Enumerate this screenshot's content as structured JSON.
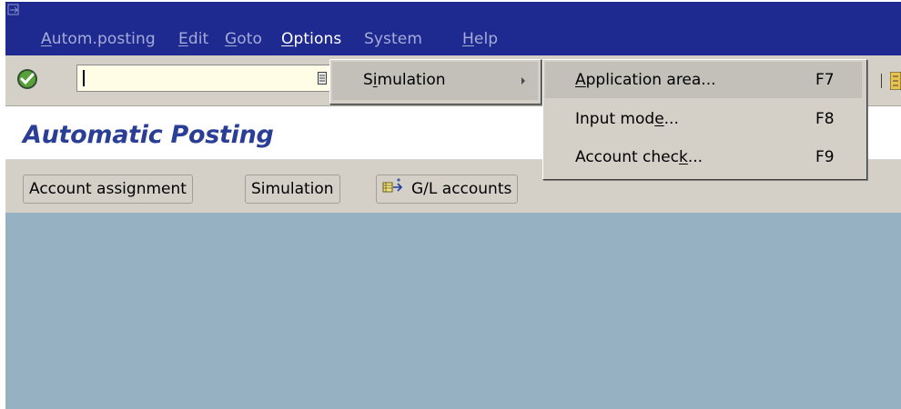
{
  "menubar": {
    "items": [
      {
        "label": "Autom.posting",
        "mn": 0
      },
      {
        "label": "Edit",
        "mn": 0
      },
      {
        "label": "Goto",
        "mn": 0
      },
      {
        "label": "Options",
        "mn": 0
      },
      {
        "label": "System",
        "mn": -1
      },
      {
        "label": "Help",
        "mn": 0
      }
    ]
  },
  "toolbar": {
    "command_field_value": ""
  },
  "page": {
    "title": "Automatic Posting"
  },
  "app_toolbar": {
    "buttons": [
      {
        "label": "Account assignment"
      },
      {
        "label": "Simulation"
      },
      {
        "label": "G/L accounts",
        "icon": "gl-accounts-icon"
      }
    ]
  },
  "options_menu": {
    "items": [
      {
        "label": "Simulation",
        "has_submenu": true,
        "highlighted": true
      }
    ]
  },
  "simulation_submenu": {
    "items": [
      {
        "label": "Application area...",
        "shortcut": "F7",
        "highlighted": true
      },
      {
        "label": "Input mode...",
        "shortcut": "F8",
        "highlighted": false
      },
      {
        "label": "Account check...",
        "shortcut": "F9",
        "highlighted": false
      }
    ]
  },
  "colors": {
    "menubar_bg": "#1e2a8f",
    "workspace_bg": "#96b1c2",
    "title_color": "#2a3e95",
    "toolbar_bg": "#d4d0c8"
  }
}
